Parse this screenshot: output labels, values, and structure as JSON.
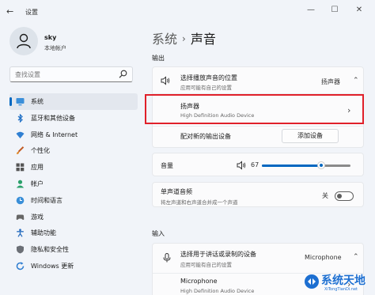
{
  "window": {
    "title": "设置",
    "controls": {
      "minimize": "—",
      "maximize": "☐",
      "close": "✕"
    }
  },
  "profile": {
    "name": "sky",
    "account_type": "本地帐户"
  },
  "search": {
    "placeholder": "查找设置"
  },
  "nav": {
    "items": [
      {
        "label": "系统",
        "icon": "monitor-icon",
        "active": true
      },
      {
        "label": "蓝牙和其他设备",
        "icon": "bluetooth-icon"
      },
      {
        "label": "网络 & Internet",
        "icon": "wifi-icon"
      },
      {
        "label": "个性化",
        "icon": "brush-icon"
      },
      {
        "label": "应用",
        "icon": "apps-icon"
      },
      {
        "label": "帐户",
        "icon": "person-icon"
      },
      {
        "label": "时间和语言",
        "icon": "globe-clock-icon"
      },
      {
        "label": "游戏",
        "icon": "game-controller-icon"
      },
      {
        "label": "辅助功能",
        "icon": "accessibility-icon"
      },
      {
        "label": "隐私和安全性",
        "icon": "shield-icon"
      },
      {
        "label": "Windows 更新",
        "icon": "update-icon"
      }
    ]
  },
  "breadcrumb": {
    "parent": "系统",
    "separator": "›",
    "current": "声音"
  },
  "output": {
    "heading": "输出",
    "choose_device": {
      "label": "选择播放声音的位置",
      "sub": "应用可能有自己的设置",
      "value": "扬声器"
    },
    "speaker": {
      "label": "扬声器",
      "sub": "High Definition Audio Device",
      "chevron": "›"
    },
    "pair": {
      "label": "配对新的输出设备",
      "button": "添加设备"
    },
    "volume": {
      "label": "音量",
      "value": 67,
      "value_text": "67"
    },
    "mono": {
      "label": "单声道音频",
      "sub": "将左声道和右声道合并成一个声道",
      "state": "关",
      "on": false
    }
  },
  "input": {
    "heading": "输入",
    "choose_device": {
      "label": "选择用于讲话或录制的设备",
      "sub": "应用可能有自己的设置",
      "value": "Microphone"
    },
    "microphone": {
      "label": "Microphone",
      "sub": "High Definition Audio Device",
      "chevron": "›"
    }
  },
  "watermark": {
    "text": "系统天地",
    "url": "XiTongTianDi.net"
  },
  "colors": {
    "accent": "#0067c0",
    "highlight_border": "#e0202a",
    "watermark": "#1d6fd1"
  }
}
